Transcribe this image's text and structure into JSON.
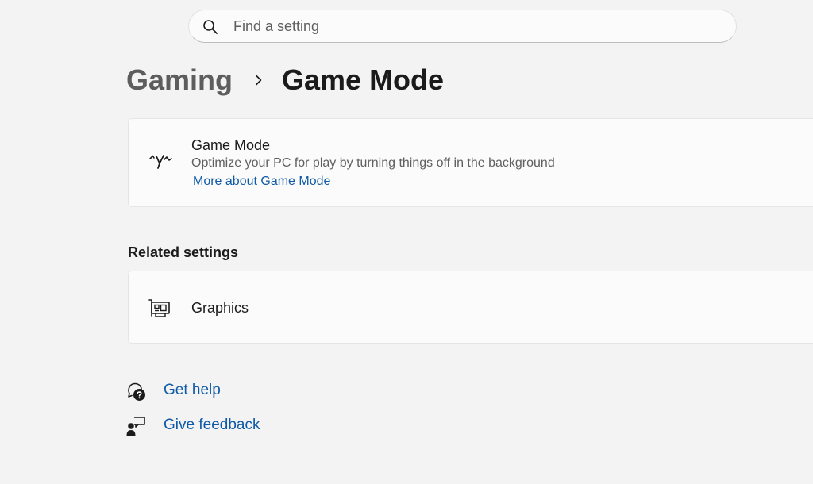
{
  "search": {
    "placeholder": "Find a setting",
    "icon": "search-icon"
  },
  "breadcrumb": {
    "parent": "Gaming",
    "separator_icon": "chevron-right-icon",
    "current": "Game Mode"
  },
  "game_mode_card": {
    "icon": "game-mode-icon",
    "title": "Game Mode",
    "description": "Optimize your PC for play by turning things off in the background",
    "link": "More about Game Mode"
  },
  "related_settings": {
    "header": "Related settings",
    "items": [
      {
        "icon": "graphics-card-icon",
        "label": "Graphics"
      }
    ]
  },
  "help": {
    "get_help": {
      "icon": "help-icon",
      "label": "Get help"
    },
    "give_feedback": {
      "icon": "feedback-icon",
      "label": "Give feedback"
    }
  },
  "colors": {
    "background": "#f3f3f3",
    "card": "#fbfbfb",
    "link": "#0f5aa6",
    "text": "#1b1b1b",
    "secondary_text": "#5f5f5f"
  }
}
